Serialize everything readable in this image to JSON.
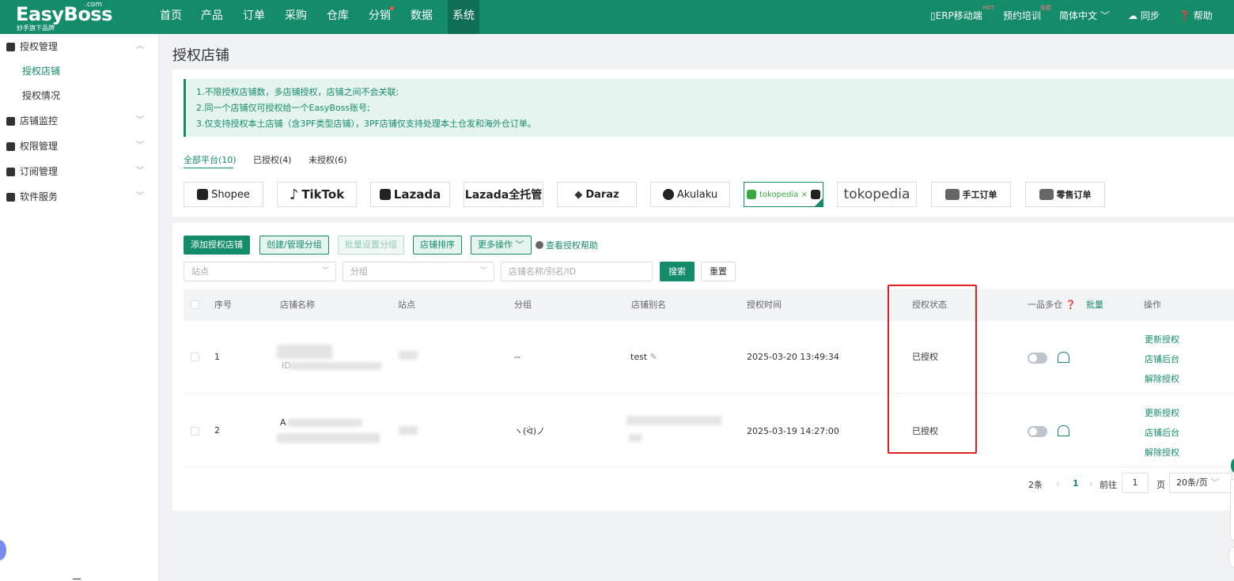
{
  "brand": {
    "name": "EasyBoss",
    "com": ".com",
    "tagline": "妙手旗下品牌"
  },
  "nav": {
    "items": [
      "首页",
      "产品",
      "订单",
      "采购",
      "仓库",
      "分销",
      "数据",
      "系统"
    ],
    "active": "系统",
    "right": {
      "erp_mobile": "ERP移动端",
      "erp_tag": "HOT",
      "training": "预约培训",
      "training_tag": "免费",
      "language": "简体中文",
      "sync": "同步",
      "help": "帮助"
    }
  },
  "sidebar": {
    "groups": [
      {
        "label": "授权管理",
        "icon": "authorization-icon",
        "expanded": true,
        "children": [
          "授权店铺",
          "授权情况"
        ],
        "active_child": "授权店铺"
      },
      {
        "label": "店铺监控",
        "icon": "store-monitor-icon"
      },
      {
        "label": "权限管理",
        "icon": "permission-icon"
      },
      {
        "label": "订阅管理",
        "icon": "subscription-icon"
      },
      {
        "label": "软件服务",
        "icon": "software-service-icon"
      }
    ]
  },
  "page": {
    "title": "授权店铺",
    "notices": [
      "1.不限授权店铺数，多店铺授权，店铺之间不会关联;",
      "2.同一个店铺仅可授权给一个EasyBoss账号;",
      "3.仅支持授权本土店铺（含3PF类型店铺），3PF店铺仅支持处理本土仓发和海外仓订单。"
    ],
    "filter_tabs": [
      "全部平台(10)",
      "已授权(4)",
      "未授权(6)"
    ],
    "active_filter": "全部平台(10)",
    "platforms": [
      "Shopee",
      "TikTok",
      "Lazada",
      "Lazada全托管",
      "Daraz",
      "Akulaku",
      "tokopedia ×",
      "tokopedia",
      "手工订单",
      "零售订单"
    ],
    "selected_platform": "tokopedia ×"
  },
  "toolbar": {
    "add": "添加授权店铺",
    "group_manage": "创建/管理分组",
    "batch_group": "批量设置分组",
    "sort": "店铺排序",
    "more": "更多操作",
    "help": "查看授权帮助"
  },
  "search": {
    "site_placeholder": "站点",
    "group_placeholder": "分组",
    "keyword_placeholder": "店铺名称/别名/ID",
    "search": "搜索",
    "reset": "重置"
  },
  "table": {
    "headers": [
      "序号",
      "店铺名称",
      "站点",
      "分组",
      "店铺别名",
      "授权时间",
      "授权状态",
      "一品多仓",
      "批量",
      "操作"
    ],
    "rows": [
      {
        "index": "1",
        "name_suffix": "ID",
        "group": "--",
        "alias": "test",
        "time": "2025-03-20 13:49:34",
        "status": "已授权"
      },
      {
        "index": "2",
        "name_prefix": "A",
        "group": "ヽ(ᐛ)ノ",
        "alias": "",
        "time": "2025-03-19 14:27:00",
        "status": "已授权"
      }
    ],
    "actions": [
      "更新授权",
      "店铺后台",
      "解除授权"
    ]
  },
  "pagination": {
    "total": "2条",
    "current": "1",
    "goto_label": "前往",
    "goto_value": "1",
    "page_unit": "页",
    "page_size": "20条/页"
  },
  "colors": {
    "brand": "#148c6a",
    "highlight": "#e02020"
  }
}
